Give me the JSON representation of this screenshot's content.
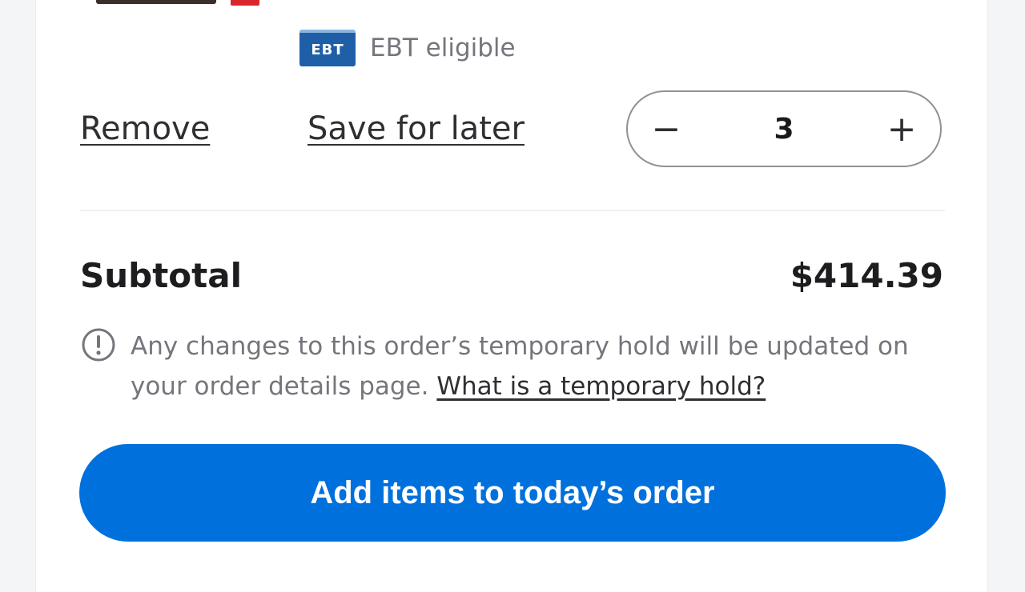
{
  "item": {
    "ebt_logo_text": "EBT",
    "ebt_label": "EBT eligible",
    "remove_label": "Remove",
    "save_label": "Save for later",
    "quantity": "3",
    "decrement_symbol": "−",
    "increment_symbol": "+"
  },
  "summary": {
    "subtotal_label": "Subtotal",
    "subtotal_value": "$414.39",
    "notice_text": "Any changes to this order’s temporary hold will be updated on your order details page.",
    "notice_link": "What is a temporary hold?"
  },
  "cta": {
    "label": "Add items to today’s order"
  },
  "icons": {
    "info": "info-circle-icon",
    "minus": "minus-icon",
    "plus": "plus-icon"
  },
  "colors": {
    "accent": "#0071dc",
    "ebt_blue": "#1f5fa8",
    "muted_text": "#74767c"
  }
}
